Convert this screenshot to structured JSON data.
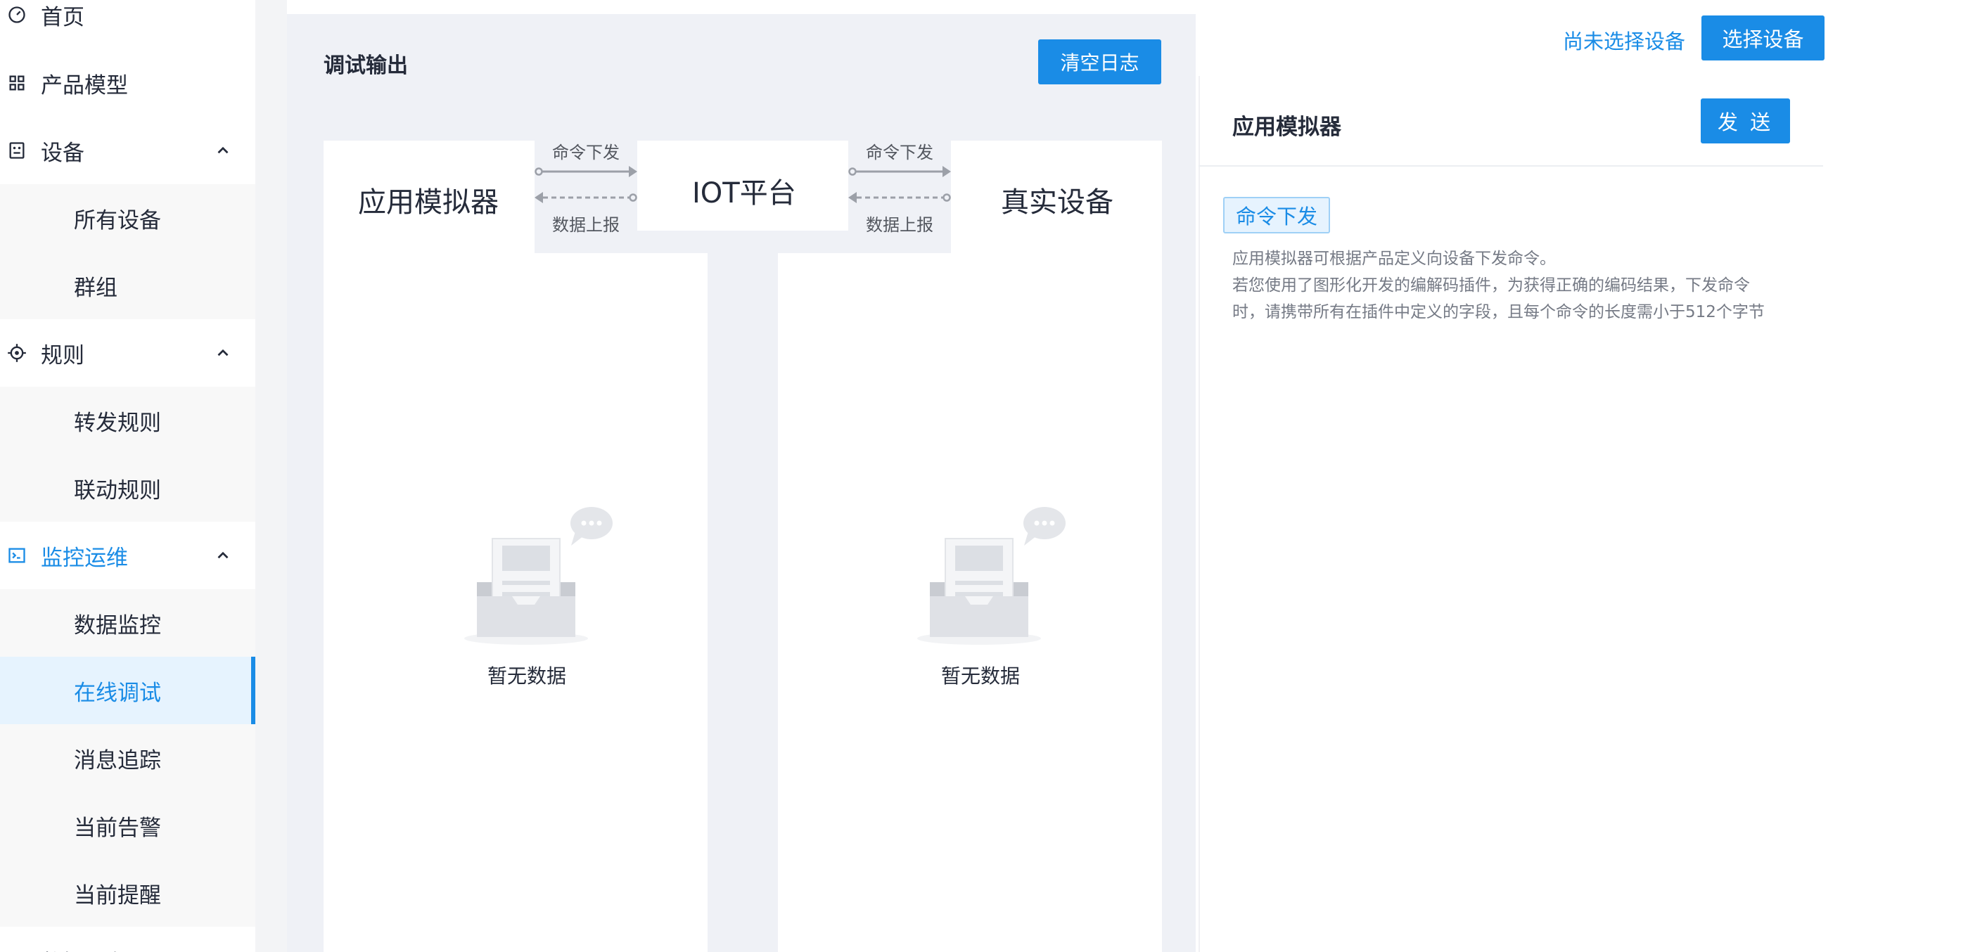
{
  "sidebar": {
    "home": "首页",
    "product_model": "产品模型",
    "devices": "设备",
    "all_devices": "所有设备",
    "groups": "群组",
    "rules": "规则",
    "forward_rules": "转发规则",
    "linkage_rules": "联动规则",
    "monitoring": "监控运维",
    "data_monitoring": "数据监控",
    "online_debug": "在线调试",
    "message_trace": "消息追踪",
    "current_alarms": "当前告警",
    "current_reminders": "当前提醒",
    "partial_next": "数据服务"
  },
  "debug": {
    "title": "调试输出",
    "clear_log": "清空日志",
    "app_simulator": "应用模拟器",
    "iot_platform": "IOT平台",
    "real_device": "真实设备",
    "cmd_down": "命令下发",
    "data_up": "数据上报",
    "empty": "暂无数据"
  },
  "right": {
    "no_device": "尚未选择设备",
    "select_device": "选择设备",
    "sim_title": "应用模拟器",
    "send": "发 送",
    "cmd_tag": "命令下发",
    "desc1": "应用模拟器可根据产品定义向设备下发命令。",
    "desc2": "若您使用了图形化开发的编解码插件，为获得正确的编码结果，下发命令",
    "desc3": "时，请携带所有在插件中定义的字段，且每个命令的长度需小于512个字节"
  },
  "colors": {
    "accent": "#1a8ce6",
    "panel_bg": "#eff1f6"
  }
}
